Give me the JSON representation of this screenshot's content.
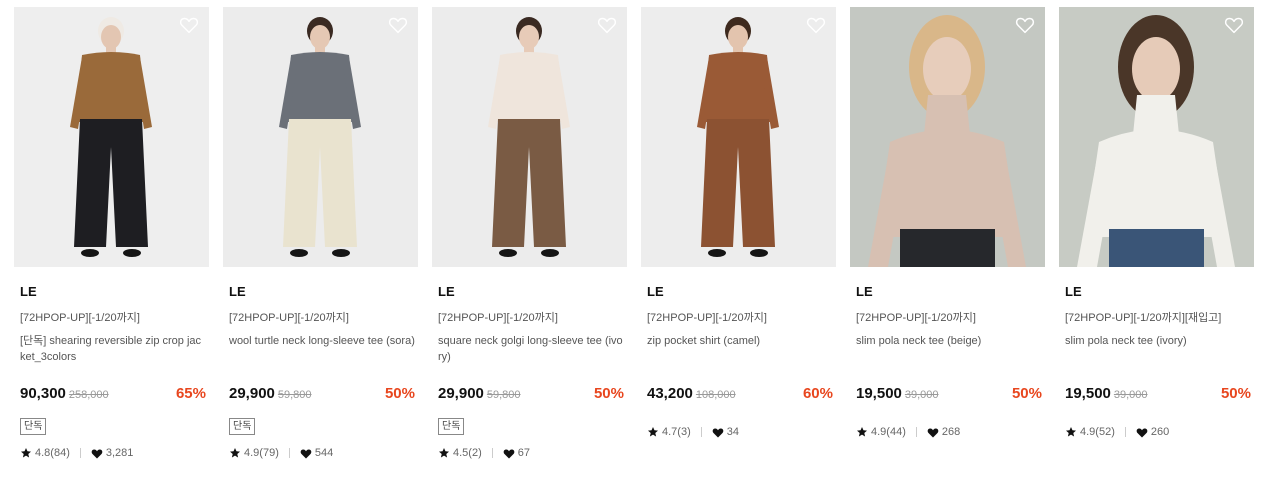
{
  "products": [
    {
      "brand": "LE",
      "promo": "[72HPOP-UP][-1/20까지]",
      "name": "[단독] shearing reversible zip crop jacket_3colors",
      "price": "90,300",
      "original_price": "258,000",
      "discount": "65%",
      "badge": "단독",
      "rating": "4.8(84)",
      "likes": "3,281",
      "bg": "#eeeeee",
      "colors": {
        "top": "#9a6a3a",
        "bottom": "#1e1e22",
        "skin": "#e3c6b2",
        "hair": "#efeae4"
      }
    },
    {
      "brand": "LE",
      "promo": "[72HPOP-UP][-1/20까지]",
      "name": "wool turtle neck long-sleeve tee (sora)",
      "price": "29,900",
      "original_price": "59,800",
      "discount": "50%",
      "badge": "단독",
      "rating": "4.9(79)",
      "likes": "544",
      "bg": "#ececec",
      "colors": {
        "top": "#6b7078",
        "bottom": "#e9e3cf",
        "skin": "#e5c8b4",
        "hair": "#3a2a22"
      }
    },
    {
      "brand": "LE",
      "promo": "[72HPOP-UP][-1/20까지]",
      "name": "square neck golgi long-sleeve tee (ivory)",
      "price": "29,900",
      "original_price": "59,800",
      "discount": "50%",
      "badge": "단독",
      "rating": "4.5(2)",
      "likes": "67",
      "bg": "#ececec",
      "colors": {
        "top": "#efe5dc",
        "bottom": "#7a5b44",
        "skin": "#e7cbb8",
        "hair": "#3a2a22"
      }
    },
    {
      "brand": "LE",
      "promo": "[72HPOP-UP][-1/20까지]",
      "name": "zip pocket shirt (camel)",
      "price": "43,200",
      "original_price": "108,000",
      "discount": "60%",
      "badge": "",
      "rating": "4.7(3)",
      "likes": "34",
      "bg": "#ededed",
      "colors": {
        "top": "#9a5a36",
        "bottom": "#8c5232",
        "skin": "#e3c4ae",
        "hair": "#3e2a1e"
      }
    },
    {
      "brand": "LE",
      "promo": "[72HPOP-UP][-1/20까지]",
      "name": "slim pola neck tee (beige)",
      "price": "19,500",
      "original_price": "39,000",
      "discount": "50%",
      "badge": "",
      "rating": "4.9(44)",
      "likes": "268",
      "bg": "#c4c8c2",
      "colors": {
        "top": "#d7c0b2",
        "bottom": "#26282c",
        "skin": "#e7cdbb",
        "hair": "#d9b789"
      }
    },
    {
      "brand": "LE",
      "promo": "[72HPOP-UP][-1/20까지][재입고]",
      "name": "slim pola neck tee (ivory)",
      "price": "19,500",
      "original_price": "39,000",
      "discount": "50%",
      "badge": "",
      "rating": "4.9(52)",
      "likes": "260",
      "bg": "#c7cbc4",
      "colors": {
        "top": "#f1f0eb",
        "bottom": "#3a5577",
        "skin": "#e6cbb8",
        "hair": "#4a3628"
      }
    }
  ]
}
